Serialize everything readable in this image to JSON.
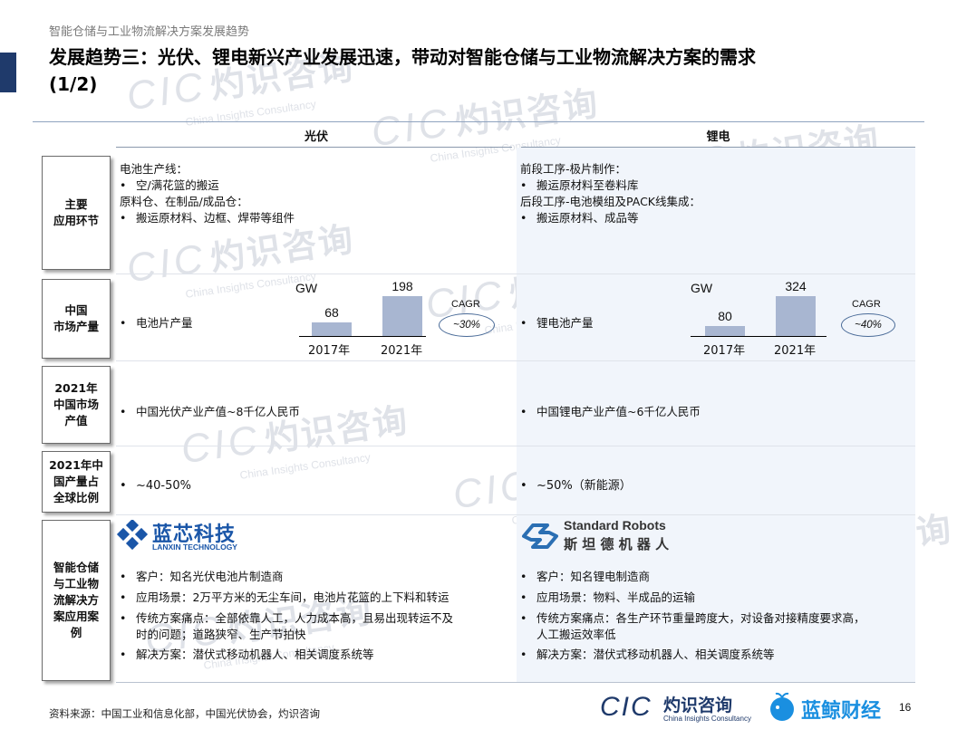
{
  "header": {
    "top_label": "智能仓储与工业物流解决方案发展趋势",
    "title_line1": "发展趋势三：光伏、锂电新兴产业发展迅速，带动对智能仓储与工业物流解决方案的需求",
    "title_line2": "(1/2)"
  },
  "columns": {
    "left": "光伏",
    "right": "锂电"
  },
  "rows": {
    "r1": {
      "label": "主要\n应用环节",
      "left": [
        {
          "type": "plain",
          "text": "电池生产线："
        },
        {
          "type": "bullet",
          "text": "空/满花篮的搬运"
        },
        {
          "type": "plain",
          "text": "原料仓、在制品/成品仓："
        },
        {
          "type": "bullet",
          "text": "搬运原材料、边框、焊带等组件"
        }
      ],
      "right": [
        {
          "type": "plain",
          "text": "前段工序-极片制作："
        },
        {
          "type": "bullet",
          "text": "搬运原材料至卷料库"
        },
        {
          "type": "plain",
          "text": "后段工序-电池模组及PACK线集成："
        },
        {
          "type": "bullet",
          "text": "搬运原材料、成品等"
        }
      ]
    },
    "r2": {
      "label": "中国\n市场产量",
      "left_text": "电池片产量",
      "right_text": "锂电池产量"
    },
    "r3": {
      "label": "2021年\n中国市场\n产值",
      "left_text": "中国光伏产业产值~8千亿人民币",
      "right_text": "中国锂电产业产值~6千亿人民币"
    },
    "r4": {
      "label": "2021年中\n国产量占\n全球比例",
      "left_text": "~40-50%",
      "right_text": "~50%（新能源）"
    },
    "r5": {
      "label": "智能仓储\n与工业物\n流解决方\n案应用案\n例",
      "left_logo": {
        "name": "蓝芯科技",
        "sub": "LANXIN TECHNOLOGY",
        "color": "#1a56a8"
      },
      "right_logo": {
        "name": "Standard Robots",
        "sub": "斯 坦 德 机 器 人",
        "color": "#333333"
      },
      "left_bullets": [
        "客户：知名光伏电池片制造商",
        "应用场景：2万平方米的无尘车间，电池片花篮的上下料和转运",
        "传统方案痛点：全部依靠人工，人力成本高，且易出现转运不及",
        "解决方案：潜伏式移动机器人、相关调度系统等"
      ],
      "left_cont": "时的问题；道路狭窄、生产节拍快",
      "right_bullets": [
        "客户：知名锂电制造商",
        "应用场景：物料、半成品的运输",
        "传统方案痛点：各生产环节重量跨度大，对设备对接精度要求高，",
        "解决方案：潜伏式移动机器人、相关调度系统等"
      ],
      "right_cont": "人工搬运效率低"
    }
  },
  "chart_data": [
    {
      "type": "bar",
      "unit_label": "GW",
      "categories": [
        "2017年",
        "2021年"
      ],
      "values": [
        68,
        198
      ],
      "cagr_label": "CAGR",
      "cagr_value": "~30%"
    },
    {
      "type": "bar",
      "unit_label": "GW",
      "categories": [
        "2017年",
        "2021年"
      ],
      "values": [
        80,
        324
      ],
      "cagr_label": "CAGR",
      "cagr_value": "~40%"
    }
  ],
  "footer": {
    "source": "资料来源：中国工业和信息化部，中国光伏协会，灼识咨询",
    "cic_logo": "CIC",
    "cic_cn": "灼识咨询",
    "cic_en": "China Insights Consultancy",
    "partner": "蓝鲸财经",
    "page": "16"
  },
  "watermark": {
    "cic": "CIC",
    "cn": "灼识咨询",
    "en": "China Insights Consultancy"
  },
  "colors": {
    "accent": "#1f3a6b",
    "bar": "#a8b6d1",
    "right_panel": "#f1f5fb"
  }
}
